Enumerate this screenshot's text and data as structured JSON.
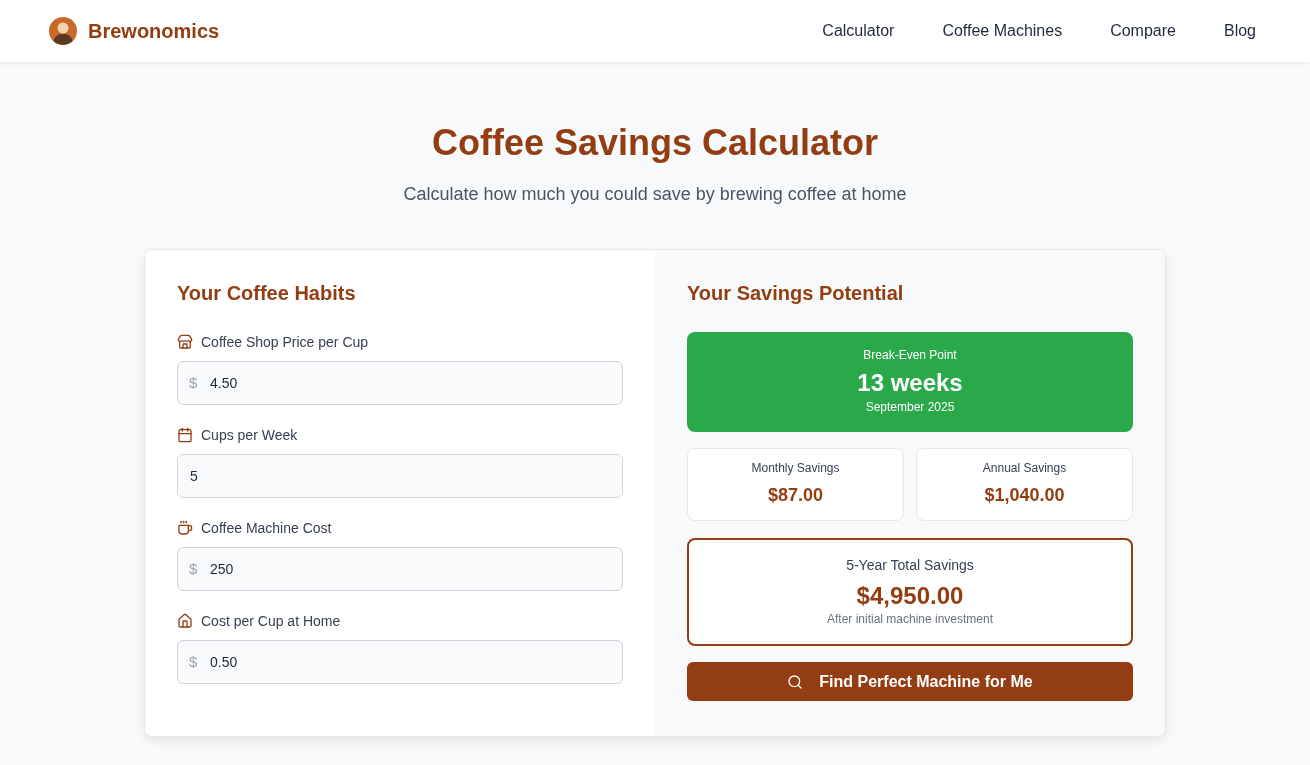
{
  "header": {
    "brand": "Brewonomics",
    "nav": [
      {
        "label": "Calculator"
      },
      {
        "label": "Coffee Machines"
      },
      {
        "label": "Compare"
      },
      {
        "label": "Blog"
      }
    ]
  },
  "hero": {
    "title": "Coffee Savings Calculator",
    "subtitle": "Calculate how much you could save by brewing coffee at home"
  },
  "habits": {
    "heading": "Your Coffee Habits",
    "fields": [
      {
        "label": "Coffee Shop Price per Cup",
        "prefix": "$",
        "value": "4.50"
      },
      {
        "label": "Cups per Week",
        "value": "5"
      },
      {
        "label": "Coffee Machine Cost",
        "prefix": "$",
        "value": "250"
      },
      {
        "label": "Cost per Cup at Home",
        "prefix": "$",
        "value": "0.50"
      }
    ]
  },
  "savings": {
    "heading": "Your Savings Potential",
    "break_even": {
      "label": "Break-Even Point",
      "value": "13 weeks",
      "date": "September 2025"
    },
    "stats": [
      {
        "label": "Monthly Savings",
        "value": "$87.00"
      },
      {
        "label": "Annual Savings",
        "value": "$1,040.00"
      }
    ],
    "total": {
      "label": "5-Year Total Savings",
      "value": "$4,950.00",
      "note": "After initial machine investment"
    },
    "button": "Find Perfect Machine for Me"
  }
}
